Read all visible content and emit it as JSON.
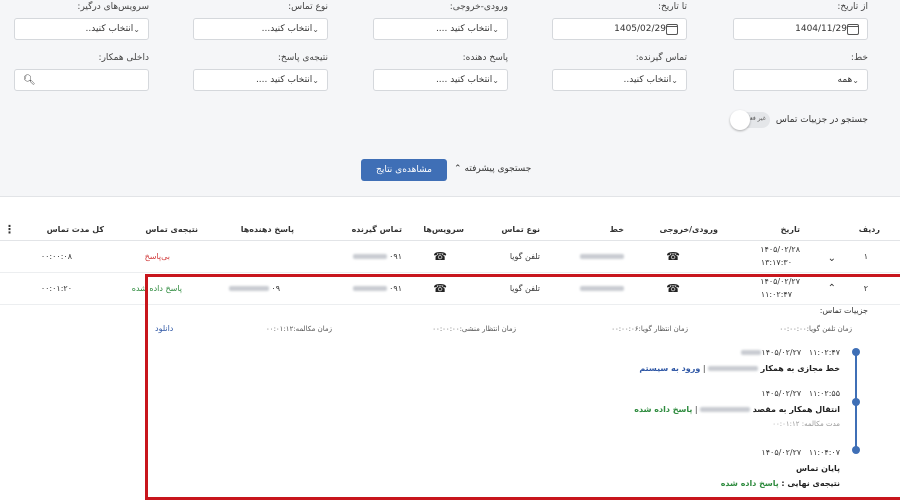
{
  "filters": {
    "from_date": {
      "label": "از تاریخ:",
      "value": "1404/11/29"
    },
    "to_date": {
      "label": "تا تاریخ:",
      "value": "1405/02/29"
    },
    "direction": {
      "label": "ورودی-خروجی:",
      "value": "انتخاب کنید ...."
    },
    "call_type": {
      "label": "نوع تماس:",
      "value": "انتخاب کنید..."
    },
    "services": {
      "label": "سرویس‌های درگیر:",
      "value": "انتخاب کنید.."
    },
    "line": {
      "label": "خط:",
      "value": "همه"
    },
    "callee": {
      "label": "تماس گیرنده:",
      "value": "انتخاب کنید.."
    },
    "responder": {
      "label": "پاسخ دهنده:",
      "value": "انتخاب کنید ...."
    },
    "result": {
      "label": "نتیجه‌ی پاسخ:",
      "value": "انتخاب کنید ...."
    },
    "extension": {
      "label": "داخلی همکار:",
      "value": ""
    }
  },
  "toggle": {
    "label": "جستجو در جزییات تماس",
    "state": "غیر فعال"
  },
  "actions": {
    "results_button": "مشاهده‌ی نتایج",
    "advanced": "جستجوی پیشرفته"
  },
  "table": {
    "headers": [
      "ردیف",
      "تاریخ",
      "ورودی/خروجی",
      "خط",
      "نوع تماس",
      "سرویس‌ها",
      "تماس گیرنده",
      "پاسخ دهنده‌ها",
      "نتیجه‌ی تماس",
      "کل مدت تماس"
    ],
    "rows": [
      {
        "index": "۱",
        "date": "۱۴۰۵/۰۲/۲۸",
        "time": "۱۳:۱۷:۳۰",
        "type": "تلفن گویا",
        "callee": "۰۹۱",
        "result": "بی‌پاسخ",
        "duration": "۰۰:۰۰:۰۸"
      },
      {
        "index": "۲",
        "date": "۱۴۰۵/۰۲/۲۷",
        "time": "۱۱:۰۲:۴۷",
        "type": "تلفن گویا",
        "callee": "۰۹۱",
        "responder": "۰۹",
        "result": "پاسخ داده شده",
        "duration": "۰۰:۰۱:۲۰"
      }
    ]
  },
  "details": {
    "title": "جزییات تماس:",
    "stats": {
      "ivr_time": "زمان تلفن گویا:۰۰:۰۰:۰۰",
      "ivr_wait": "زمان انتظار گویا:۰۰:۰۰:۰۶",
      "secretary_wait": "زمان انتظار منشی:۰۰:۰۰:۰۰",
      "talk_time": "زمان مکالمه:۰۰:۰۱:۱۲"
    },
    "download": "دانلود",
    "events": [
      {
        "date": "۱۴۰۵/۰۲/۲۷",
        "time": "۱۱:۰۲:۴۷",
        "title": "خط مجازی به همکار",
        "tag": "ورود به سیستم"
      },
      {
        "date": "۱۴۰۵/۰۲/۲۷",
        "time": "۱۱:۰۲:۵۵",
        "title": "انتقال همکار به مقصد",
        "tag": "پاسخ داده شده",
        "duration": "مدت مکالمه: ۰۰:۰۱:۱۲"
      },
      {
        "date": "۱۴۰۵/۰۲/۲۷",
        "time": "۱۱:۰۴:۰۷",
        "title": "پایان تماس",
        "result_label": "نتیجه‌ی نهایی :",
        "result": "پاسخ داده شده"
      }
    ]
  },
  "colors": {
    "primary": "#3f6fb6",
    "highlight": "#c8161d",
    "success": "#2e8b3e",
    "danger": "#d13a3a"
  }
}
